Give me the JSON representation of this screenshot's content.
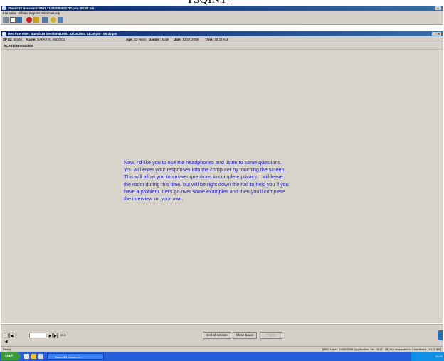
{
  "doc_heading": "TSQINT_",
  "app_window": {
    "title": "Stand410 Session410901 11/16/2004 01:30 pm - 05:30 pm",
    "close_label": "×"
  },
  "menu": [
    "File",
    "View",
    "Utilities",
    "Reports",
    "Window",
    "Help"
  ],
  "interview_window": {
    "title": "Mec Interview: Stand410 Session410901 11/16/2004 01:30 pm - 05:30 pm",
    "controls_label": "_ □ ×"
  },
  "participant": {
    "sp_id_label": "SP ID:",
    "sp_id": "80360",
    "name_label": "Name:",
    "name": "SAFAR S, ABDOOL",
    "age_label": "Age:",
    "age": "22 years",
    "gender_label": "Gender:",
    "gender": "Male",
    "date_label": "Date:",
    "date": "12/17/2008",
    "time_label": "Time:",
    "time": "10:22 AM"
  },
  "section_title": "ACASI introduction",
  "intro_text": "Now, I'd like you to use the headphones and listen to some questions.\nYou will enter your responses into the computer by touching the screen.\nThis will allow you to answer questions in complete privacy. I will leave\nthe room during this time, but will be right down the hall to help you if you\nhave a problem. Let's go over some examples and then you'll complete\nthe interview on your own.",
  "navigation": {
    "page_of": "of 3",
    "first": "|◀",
    "prev": "◀",
    "next": "▶",
    "last": "▶|"
  },
  "buttons": {
    "end_of_section": "End of Section",
    "close_exam": "Close Exam",
    "finish": "Finish"
  },
  "status": {
    "left": "Ready",
    "right": "[MEC Layer: 10/30/2008 [Application: Ver 16.12.128] Not connected to Coordinator [10:22 AM]"
  },
  "taskbar": {
    "start_label": "start",
    "task": "Stand410 Session4...",
    "clock": "10:22"
  }
}
